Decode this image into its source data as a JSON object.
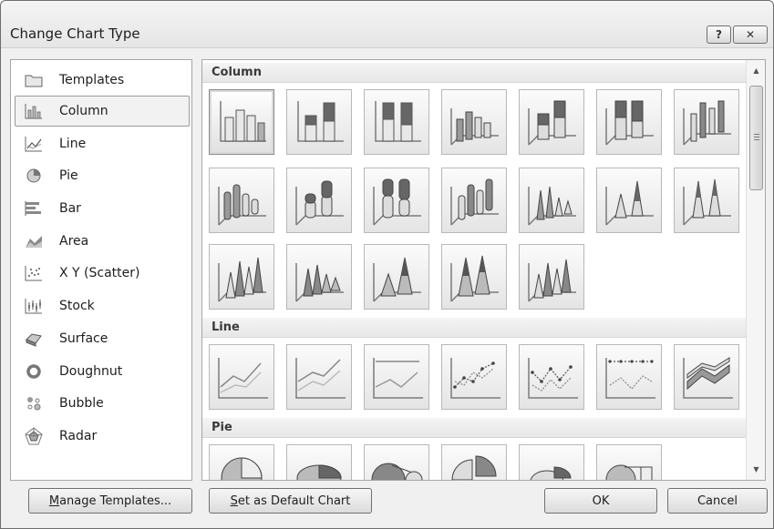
{
  "dialog": {
    "title": "Change Chart Type",
    "help_label": "?",
    "close_label": "✕"
  },
  "chart_types": [
    {
      "label": "Templates",
      "icon": "folder-icon"
    },
    {
      "label": "Column",
      "icon": "column-chart-icon",
      "selected": true
    },
    {
      "label": "Line",
      "icon": "line-chart-icon"
    },
    {
      "label": "Pie",
      "icon": "pie-chart-icon"
    },
    {
      "label": "Bar",
      "icon": "bar-chart-icon"
    },
    {
      "label": "Area",
      "icon": "area-chart-icon"
    },
    {
      "label": "X Y (Scatter)",
      "icon": "scatter-chart-icon"
    },
    {
      "label": "Stock",
      "icon": "stock-chart-icon"
    },
    {
      "label": "Surface",
      "icon": "surface-chart-icon"
    },
    {
      "label": "Doughnut",
      "icon": "doughnut-chart-icon"
    },
    {
      "label": "Bubble",
      "icon": "bubble-chart-icon"
    },
    {
      "label": "Radar",
      "icon": "radar-chart-icon"
    }
  ],
  "gallery": {
    "sections": [
      {
        "label": "Column"
      },
      {
        "label": "Line"
      },
      {
        "label": "Pie"
      }
    ]
  },
  "buttons": {
    "manage_prefix": "M",
    "manage_rest": "anage Templates...",
    "default_prefix": "S",
    "default_rest": "et as Default Chart",
    "ok": "OK",
    "cancel": "Cancel"
  },
  "colors": {
    "chart_gray_dark": "#6f6f6f",
    "chart_gray_light": "#cfcfcf",
    "axis": "#7a7a7a"
  }
}
